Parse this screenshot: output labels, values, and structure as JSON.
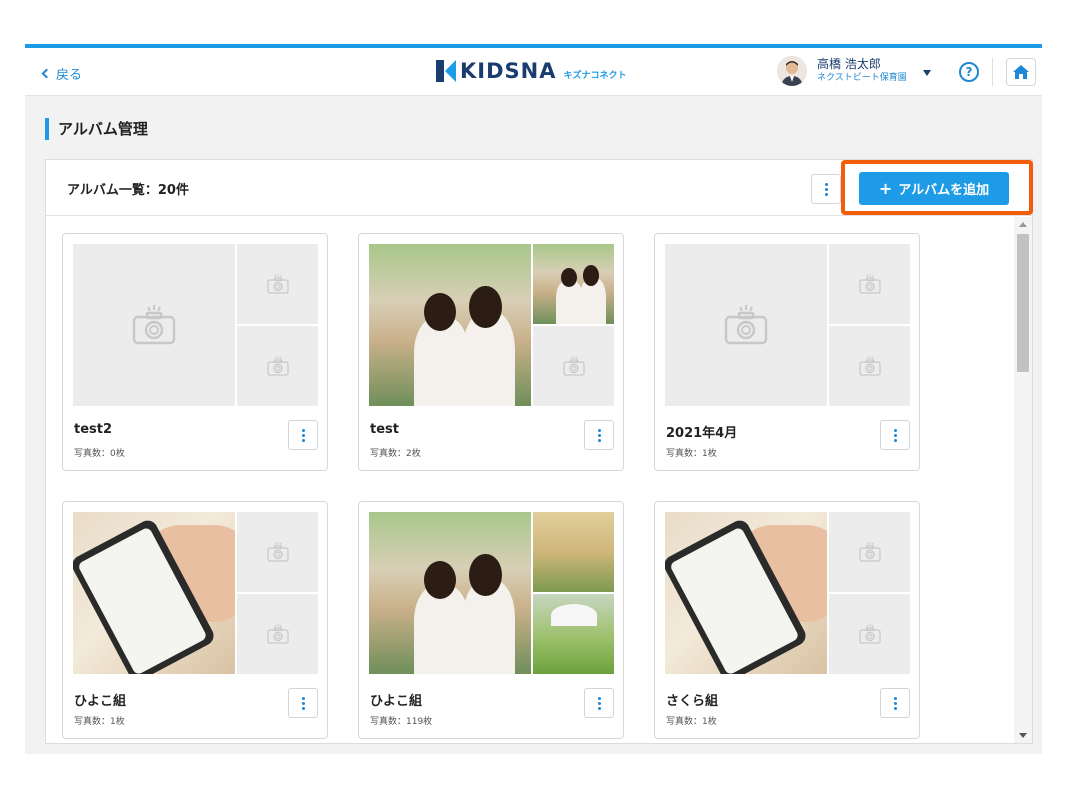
{
  "header": {
    "back_label": "戻る",
    "logo_text": "KIDSNA",
    "logo_sub": "キズナコネクト",
    "user_name": "高橋 浩太郎",
    "user_org": "ネクストビート保育園",
    "help_label": "?"
  },
  "page": {
    "title": "アルバム管理"
  },
  "panel": {
    "list_title": "アルバム一覧：20件",
    "add_button_label": "アルバムを追加",
    "add_button_icon": "+"
  },
  "albums": [
    {
      "name": "test2",
      "count": "写真数：0枚",
      "thumbs": [
        "camera",
        "camera",
        "camera"
      ]
    },
    {
      "name": "test",
      "count": "写真数：2枚",
      "thumbs": [
        "kids",
        "kids",
        "camera"
      ]
    },
    {
      "name": "2021年4月",
      "count": "写真数：1枚",
      "thumbs": [
        "camera",
        "camera",
        "camera"
      ]
    },
    {
      "name": "ひよこ組",
      "count": "写真数：1枚",
      "thumbs": [
        "phone",
        "camera",
        "camera"
      ]
    },
    {
      "name": "ひよこ組",
      "count": "写真数：119枚",
      "thumbs": [
        "kids",
        "group",
        "umbrella"
      ]
    },
    {
      "name": "さくら組",
      "count": "写真数：1枚",
      "thumbs": [
        "phone",
        "camera",
        "camera"
      ]
    }
  ],
  "colors": {
    "accent": "#1e9be6",
    "highlight": "#f25c0a",
    "navy": "#1a3c6e"
  }
}
